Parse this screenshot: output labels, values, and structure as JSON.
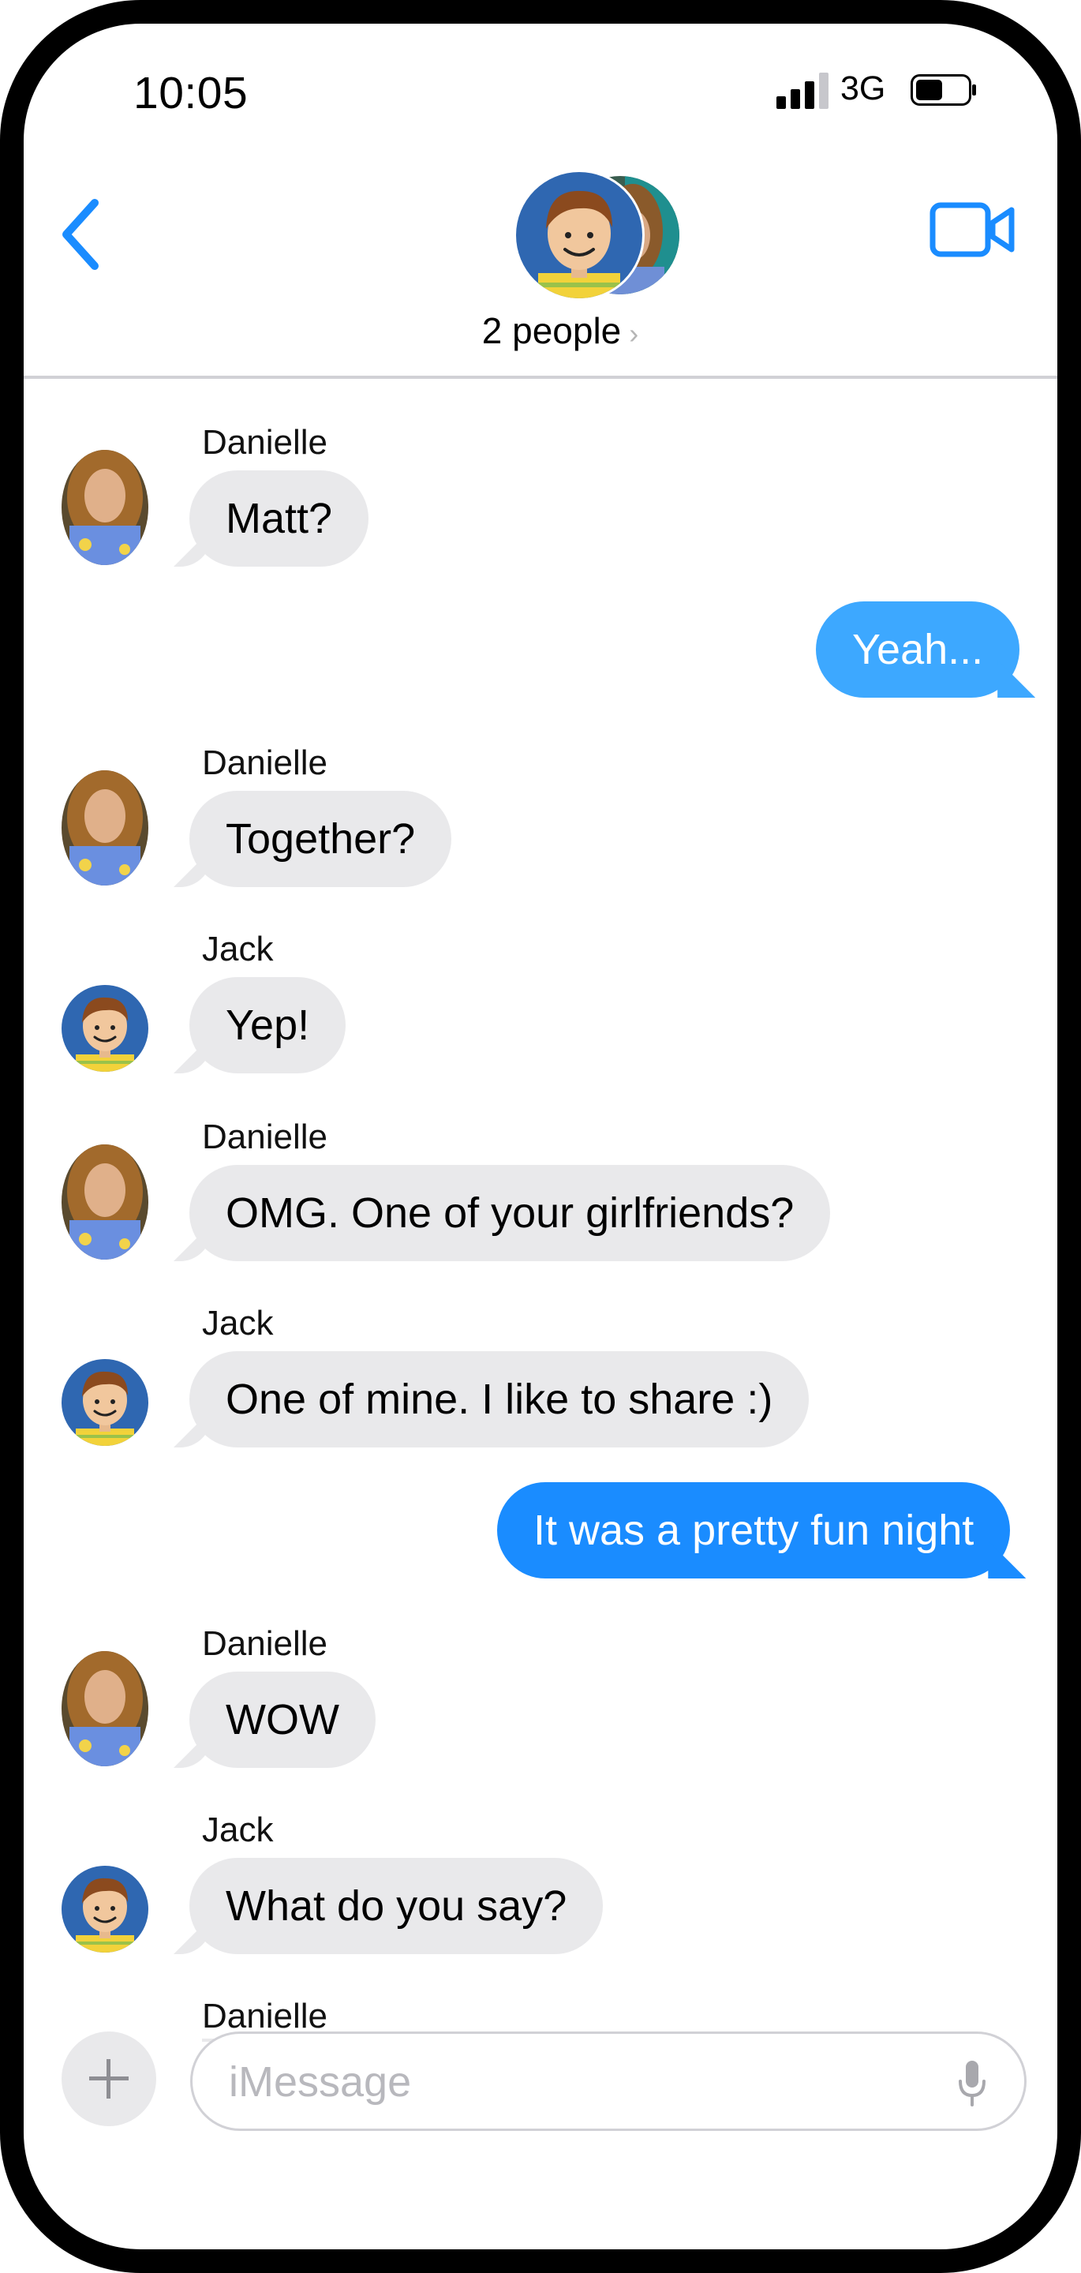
{
  "status_bar": {
    "time": "10:05",
    "network": "3G",
    "signal_icon": "signal-bars-icon",
    "battery_icon": "battery-icon"
  },
  "header": {
    "subtitle": "2 people",
    "subtitle_chevron": "›",
    "back_icon": "chevron-left-icon",
    "video_icon": "video-camera-icon"
  },
  "colors": {
    "accent": "#1a8cff",
    "incoming": "#e9e9eb",
    "outgoing_light": "#3da8ff",
    "outgoing": "#1a8cff"
  },
  "messages": [
    {
      "sender": "Danielle",
      "text": "Matt?",
      "direction": "in"
    },
    {
      "text": "Yeah...",
      "direction": "out"
    },
    {
      "sender": "Danielle",
      "text": "Together?",
      "direction": "in"
    },
    {
      "sender": "Jack",
      "text": "Yep!",
      "direction": "in"
    },
    {
      "sender": "Danielle",
      "text": "OMG.  One of your girlfriends?",
      "direction": "in"
    },
    {
      "sender": "Jack",
      "text": "One of mine.  I like to share :)",
      "direction": "in"
    },
    {
      "text": "It was a pretty fun night",
      "direction": "out"
    },
    {
      "sender": "Danielle",
      "text": "WOW",
      "direction": "in"
    },
    {
      "sender": "Jack",
      "text": "What do you say?",
      "direction": "in"
    },
    {
      "sender": "Danielle",
      "direction": "in"
    }
  ],
  "composer": {
    "placeholder": "iMessage",
    "plus_icon": "plus-icon",
    "mic_icon": "microphone-icon"
  }
}
